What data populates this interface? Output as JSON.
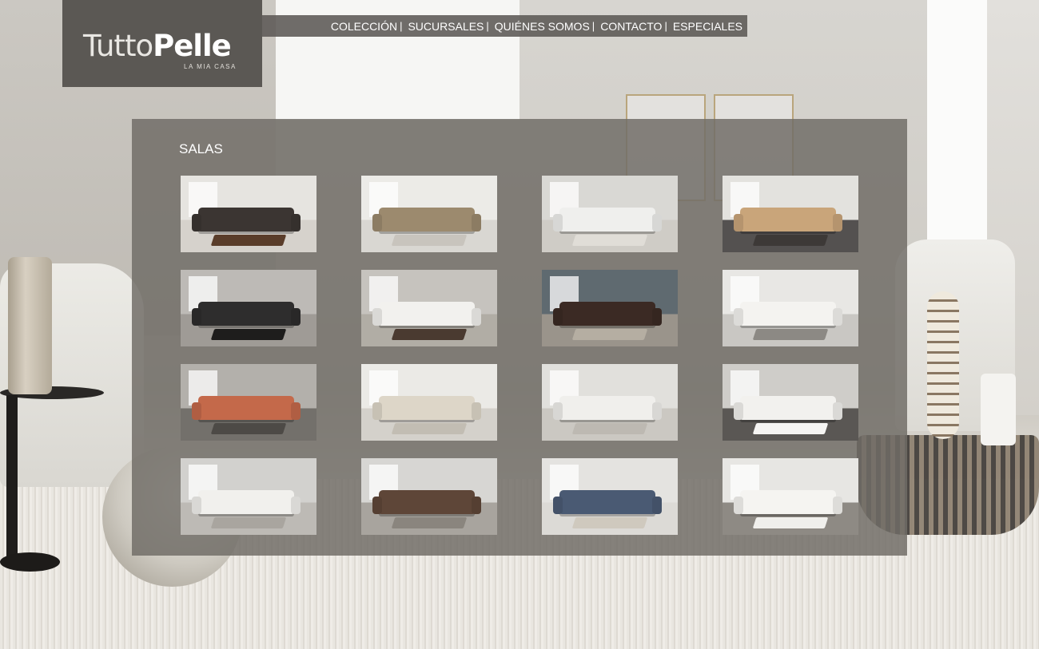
{
  "brand": {
    "logo_light": "Tutto",
    "logo_bold": "Pelle",
    "tagline": "LA MIA CASA"
  },
  "nav": [
    {
      "label": "COLECCIÓN"
    },
    {
      "label": "SUCURSALES"
    },
    {
      "label": "QUIÉNES SOMOS"
    },
    {
      "label": "CONTACTO"
    },
    {
      "label": "ESPECIALES"
    }
  ],
  "nav_separator": "|",
  "section": {
    "title": "SALAS"
  },
  "gallery": {
    "thumbnails": [
      {
        "sofa": "#3b3532",
        "wall": "#e6e4e0",
        "floor": "#d6d2cc",
        "rug": "#5a3d2a"
      },
      {
        "sofa": "#9c8a6e",
        "wall": "#ecebe7",
        "floor": "#d9d7d2",
        "rug": "#c8c4bd"
      },
      {
        "sofa": "#efefed",
        "wall": "#d9d8d4",
        "floor": "#cfccc6",
        "rug": "#e0ddd7"
      },
      {
        "sofa": "#c9a57a",
        "wall": "#e3e2de",
        "floor": "#545150",
        "rug": "#3d3937"
      },
      {
        "sofa": "#2e2d2d",
        "wall": "#bdbab6",
        "floor": "#9f9b96",
        "rug": "#1e1d1c"
      },
      {
        "sofa": "#f2f1ee",
        "wall": "#c6c3be",
        "floor": "#b1ada5",
        "rug": "#4a3a30"
      },
      {
        "sofa": "#3b2a24",
        "wall": "#5f6a70",
        "floor": "#9a948b",
        "rug": "#b5aea2"
      },
      {
        "sofa": "#f4f3f0",
        "wall": "#e8e7e4",
        "floor": "#c9c7c3",
        "rug": "#8c8984"
      },
      {
        "sofa": "#c4694a",
        "wall": "#b3b0ab",
        "floor": "#73706b",
        "rug": "#4d4a46"
      },
      {
        "sofa": "#ddd6c8",
        "wall": "#ebeae6",
        "floor": "#d4d1cb",
        "rug": "#c2bdb3"
      },
      {
        "sofa": "#f0efec",
        "wall": "#e1e0dc",
        "floor": "#cbc8c2",
        "rug": "#bdb9b2"
      },
      {
        "sofa": "#f2f1ee",
        "wall": "#cfcdc9",
        "floor": "#5a5754",
        "rug": "#f6f5f3"
      },
      {
        "sofa": "#f1f0ed",
        "wall": "#d2d1ce",
        "floor": "#bdbab5",
        "rug": "#a9a59f"
      },
      {
        "sofa": "#5e4638",
        "wall": "#d7d6d3",
        "floor": "#a8a49e",
        "rug": "#8a857e"
      },
      {
        "sofa": "#4a5a73",
        "wall": "#e4e3e0",
        "floor": "#dcdad6",
        "rug": "#cfc9be"
      },
      {
        "sofa": "#f5f4f1",
        "wall": "#e7e6e3",
        "floor": "#8e8a84",
        "rug": "#f0efec"
      }
    ]
  }
}
